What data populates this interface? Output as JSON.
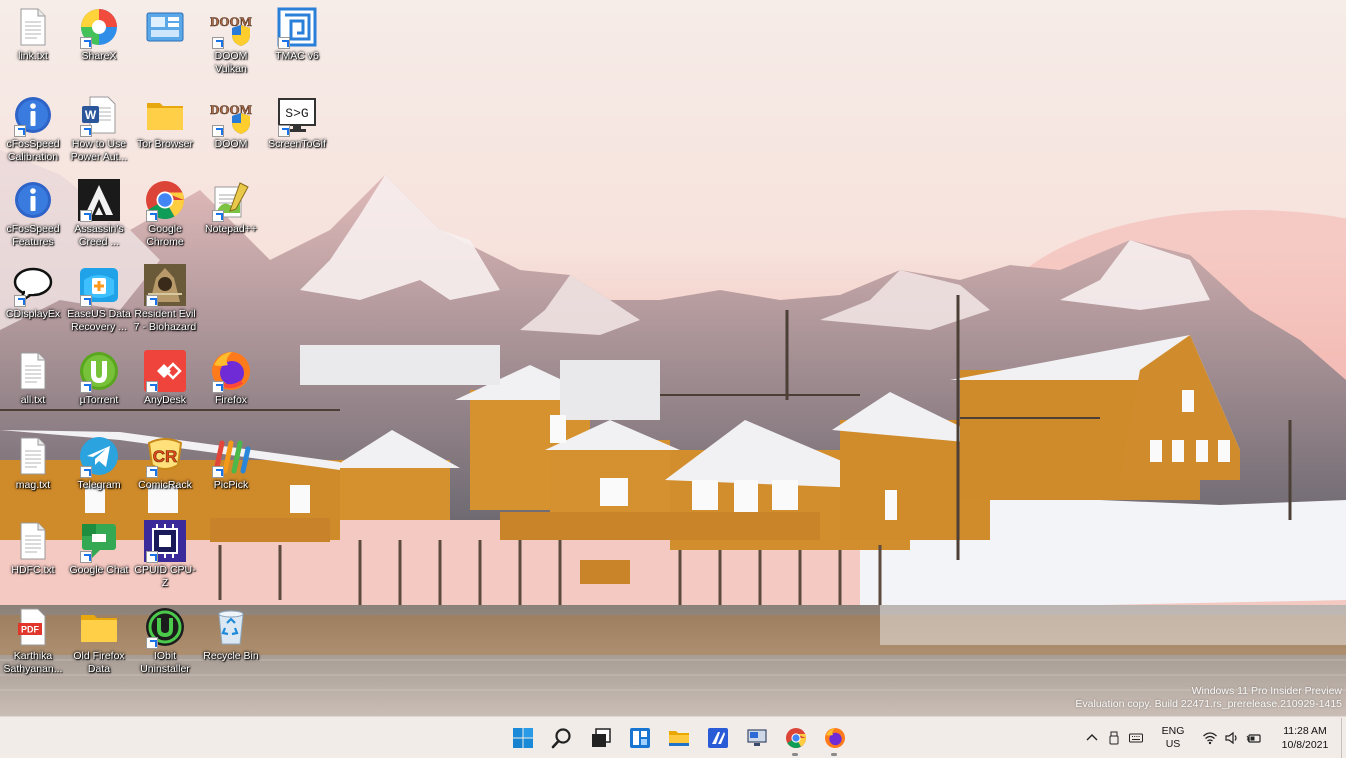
{
  "desktop": {
    "icons": [
      {
        "id": "linktxt",
        "label": "link.txt",
        "icon": "text-file-icon"
      },
      {
        "id": "sharex",
        "label": "ShareX",
        "icon": "sharex-icon"
      },
      {
        "id": "unnamed",
        "label": "",
        "icon": "control-panel-icon"
      },
      {
        "id": "doom-vulkan",
        "label": "DOOM\nVulkan",
        "icon": "doom-icon"
      },
      {
        "id": "tmac",
        "label": "TMAC v6",
        "icon": "tmac-icon"
      },
      {
        "id": "cfos-cal",
        "label": "cFosSpeed\nCalibration",
        "icon": "info-icon"
      },
      {
        "id": "how-to",
        "label": "How to Use\nPower Aut...",
        "icon": "word-icon"
      },
      {
        "id": "tor",
        "label": "Tor Browser",
        "icon": "folder-icon"
      },
      {
        "id": "doom",
        "label": "DOOM",
        "icon": "doom-icon"
      },
      {
        "id": "screentogif",
        "label": "ScreenToGif",
        "icon": "screentogif-icon"
      },
      {
        "id": "cfos-feat",
        "label": "cFosSpeed\nFeatures",
        "icon": "info-icon"
      },
      {
        "id": "assassins",
        "label": "Assassin's\nCreed ...",
        "icon": "assassins-creed-icon"
      },
      {
        "id": "chrome",
        "label": "Google\nChrome",
        "icon": "chrome-icon"
      },
      {
        "id": "notepadpp",
        "label": "Notepad++",
        "icon": "notepadpp-icon"
      },
      {
        "id": "cdisplayex",
        "label": "CDisplayEx",
        "icon": "speech-bubble-icon"
      },
      {
        "id": "easeus",
        "label": "EaseUS Data\nRecovery ...",
        "icon": "easeus-icon"
      },
      {
        "id": "resident-evil",
        "label": "Resident Evil\n7 - Biohazard",
        "icon": "resident-evil-icon"
      },
      {
        "id": "alltxt",
        "label": "all.txt",
        "icon": "text-file-icon"
      },
      {
        "id": "utorrent",
        "label": "µTorrent",
        "icon": "utorrent-icon"
      },
      {
        "id": "anydesk",
        "label": "AnyDesk",
        "icon": "anydesk-icon"
      },
      {
        "id": "firefox",
        "label": "Firefox",
        "icon": "firefox-icon"
      },
      {
        "id": "magtxt",
        "label": "mag.txt",
        "icon": "text-file-icon"
      },
      {
        "id": "telegram",
        "label": "Telegram",
        "icon": "telegram-icon"
      },
      {
        "id": "comicrack",
        "label": "ComicRack",
        "icon": "comicrack-icon"
      },
      {
        "id": "picpick",
        "label": "PicPick",
        "icon": "picpick-icon"
      },
      {
        "id": "hdfc",
        "label": "HDFC.txt",
        "icon": "text-file-icon"
      },
      {
        "id": "google-chat",
        "label": "Google Chat",
        "icon": "google-chat-icon"
      },
      {
        "id": "cpuz",
        "label": "CPUID CPU-Z",
        "icon": "cpuz-icon"
      },
      {
        "id": "karthika",
        "label": "Karthika\nSathyanan...",
        "icon": "pdf-icon"
      },
      {
        "id": "old-firefox",
        "label": "Old Firefox\nData",
        "icon": "folder-icon"
      },
      {
        "id": "iobit",
        "label": "IObit\nUninstaller",
        "icon": "iobit-icon"
      },
      {
        "id": "recycle",
        "label": "Recycle Bin",
        "icon": "recycle-bin-icon"
      }
    ]
  },
  "watermark": {
    "line1": "Windows 11 Pro Insider Preview",
    "line2": "Evaluation copy. Build 22471.rs_prerelease.210929-1415"
  },
  "taskbar": {
    "apps": [
      {
        "name": "start",
        "icon": "windows-start-icon"
      },
      {
        "name": "search",
        "icon": "search-icon"
      },
      {
        "name": "task-view",
        "icon": "task-view-icon"
      },
      {
        "name": "widgets",
        "icon": "widgets-icon"
      },
      {
        "name": "file-explorer",
        "icon": "file-explorer-icon"
      },
      {
        "name": "app-blue",
        "icon": "blue-app-icon"
      },
      {
        "name": "remote-app",
        "icon": "remote-desktop-icon"
      },
      {
        "name": "chrome",
        "icon": "chrome-icon"
      },
      {
        "name": "firefox",
        "icon": "firefox-icon"
      }
    ],
    "tray": {
      "lang_line1": "ENG",
      "lang_line2": "US",
      "time": "11:28 AM",
      "date": "10/8/2021"
    }
  }
}
